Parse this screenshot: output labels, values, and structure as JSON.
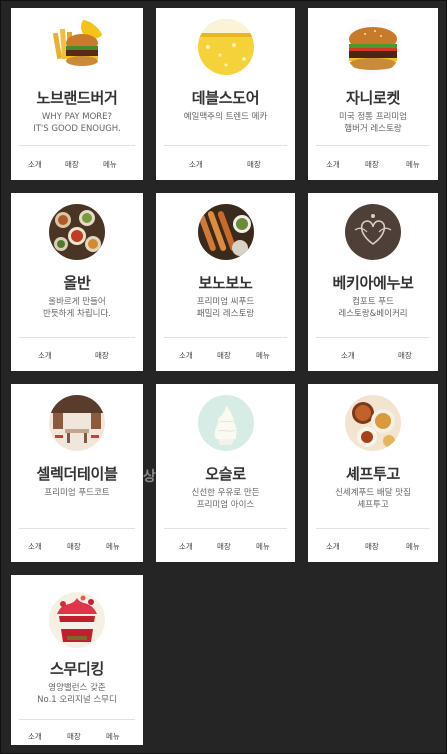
{
  "cards": [
    {
      "id": "nobrand",
      "title": "노브랜드버거",
      "desc": "WHY PAY MORE?\nIT'S GOOD ENOUGH.",
      "links": [
        "소개",
        "매장",
        "메뉴"
      ],
      "icon": "burger-fries-photo"
    },
    {
      "id": "devil",
      "title": "데블스도어",
      "desc": "예일맥주의 트렌드 메카",
      "links": [
        "소개",
        "매장"
      ],
      "icon": "beer-photo"
    },
    {
      "id": "johnny",
      "title": "자니로켓",
      "desc": "미국 정통 프리미엄\n햄버거 레스토랑",
      "links": [
        "소개",
        "매장",
        "메뉴"
      ],
      "icon": "burger-photo"
    },
    {
      "id": "olban",
      "title": "올반",
      "desc": "올바르게 만들어\n반듯하게 차립니다.",
      "links": [
        "소개",
        "매장"
      ],
      "icon": "korean-table-photo"
    },
    {
      "id": "vonovono",
      "title": "보노보노",
      "desc": "프리미엄 씨푸드\n패밀리 레스토랑",
      "links": [
        "소개",
        "매장",
        "메뉴"
      ],
      "icon": "seafood-skewer-photo"
    },
    {
      "id": "beckia",
      "title": "베키아에누보",
      "desc": "컴포트 푸드\n레스토랑&베이커리",
      "links": [
        "소개",
        "매장"
      ],
      "icon": "emblem-logo"
    },
    {
      "id": "select",
      "title": "셀렉더테이블",
      "desc": "프리미엄 푸드코트",
      "links": [
        "소개",
        "매장",
        "메뉴"
      ],
      "icon": "food-court-photo"
    },
    {
      "id": "osulloc",
      "title": "오슬로",
      "desc": "신선한 우유로 만든\n프리미엄 아이스",
      "links": [
        "소개",
        "매장",
        "메뉴"
      ],
      "icon": "soft-serve-photo"
    },
    {
      "id": "chefstogo",
      "title": "셰프투고",
      "desc": "신세계푸드 배달 맛집\n셰프투고",
      "links": [
        "소개",
        "매장",
        "메뉴"
      ],
      "icon": "chef-dishes-photo"
    },
    {
      "id": "smoothie",
      "title": "스무디킹",
      "desc": "영양밸런스 갖춘\nNo.1 오리지널 스무디",
      "links": [
        "소개",
        "매장",
        "메뉴"
      ],
      "icon": "smoothie-photo"
    }
  ],
  "overflow_text": "상을"
}
